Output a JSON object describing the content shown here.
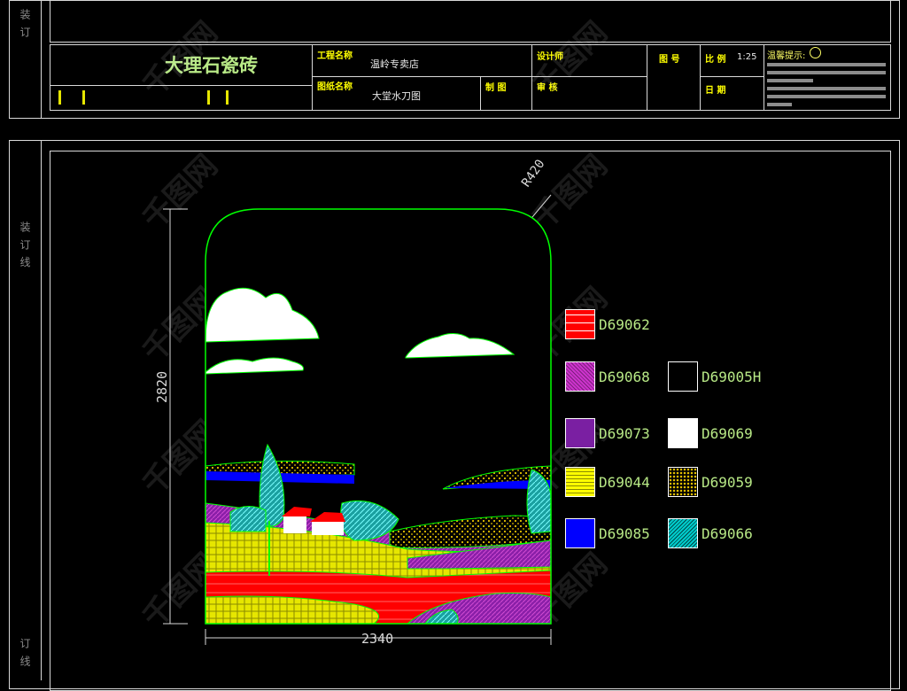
{
  "binding_labels": {
    "top": "装 订",
    "mid": "装 订 线",
    "bottom": "订 线"
  },
  "title_block": {
    "company": "大理石瓷砖",
    "project_label": "工程名称",
    "project_value": "温岭专卖店",
    "drawing_label": "图纸名称",
    "drawing_value": "大堂水刀图",
    "designer_label": "设计师",
    "draw_label": "制 图",
    "review_label": "审 核",
    "number_label": "图 号",
    "scale_label": "比 例",
    "scale_value": "1:25",
    "date_label": "日 期",
    "tips_label": "温馨提示:"
  },
  "drawing": {
    "height_dim": "2820",
    "width_dim": "2340",
    "radius": "R420"
  },
  "legend": [
    {
      "code": "D69062",
      "color": "#ff0000",
      "pattern": "stripes-h"
    },
    {
      "code": "D69068",
      "color": "#cc33cc",
      "pattern": "dense"
    },
    {
      "code": "D69005H",
      "color": "#000000",
      "pattern": "none"
    },
    {
      "code": "D69073",
      "color": "#7a1fa2",
      "pattern": "solid"
    },
    {
      "code": "D69069",
      "color": "#ffffff",
      "pattern": "solid"
    },
    {
      "code": "D69044",
      "color": "#ffff00",
      "pattern": "grid"
    },
    {
      "code": "D69059",
      "color": "#e6c200",
      "pattern": "dots"
    },
    {
      "code": "D69085",
      "color": "#0000ff",
      "pattern": "solid"
    },
    {
      "code": "D69066",
      "color": "#00cccc",
      "pattern": "diag"
    }
  ],
  "watermark": "千图网"
}
